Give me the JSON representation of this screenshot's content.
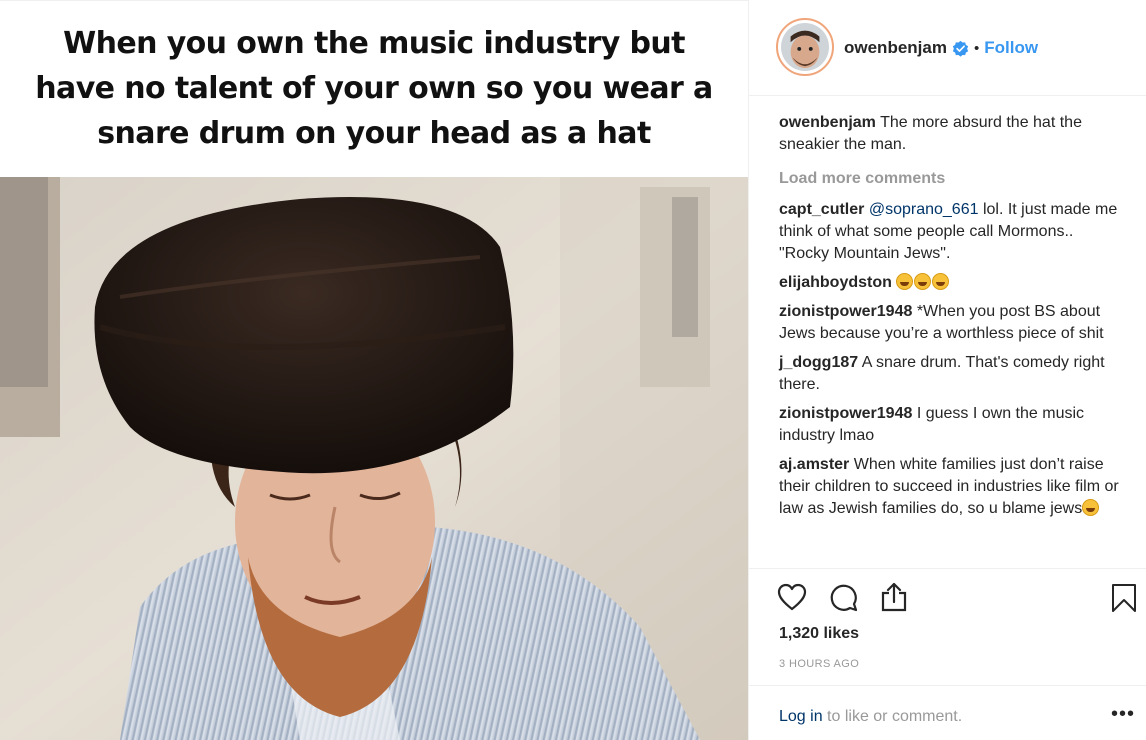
{
  "media": {
    "caption": "When you own the music industry but have no talent of your own so you wear a snare drum on your head as a hat"
  },
  "header": {
    "username": "owenbenjam",
    "separator": "•",
    "follow_label": "Follow",
    "verified_icon": "verified-badge-icon"
  },
  "caption_comment": {
    "user": "owenbenjam",
    "text": "The more absurd the hat the sneakier the man."
  },
  "load_more_label": "Load more comments",
  "comments": [
    {
      "user": "capt_cutler",
      "mention": "@soprano_661",
      "text": "lol. It just made me think of what some people call Mormons.. \"Rocky Mountain Jews\"."
    },
    {
      "user": "elijahboydston",
      "mention": "",
      "text": "",
      "emoji_count": 3
    },
    {
      "user": "zionistpower1948",
      "mention": "",
      "text": "*When you post BS about Jews because you’re a worthless piece of shit"
    },
    {
      "user": "j_dogg187",
      "mention": "",
      "text": "A snare drum. That's comedy right there."
    },
    {
      "user": "zionistpower1948",
      "mention": "",
      "text": "I guess I own the music industry lmao"
    },
    {
      "user": "aj.amster",
      "mention": "",
      "text": "When white families just don’t raise their children to succeed in industries like film or law as Jewish families do, so u blame jews",
      "emoji_count": 1
    }
  ],
  "actions": {
    "icons": [
      "heart-icon",
      "comment-bubble-icon",
      "share-icon",
      "bookmark-icon"
    ],
    "likes": "1,320 likes",
    "time": "3 HOURS AGO"
  },
  "login": {
    "link": "Log in",
    "rest": " to like or comment.",
    "more": "•••"
  },
  "colors": {
    "link_blue": "#3897f0",
    "mention_blue": "#003569",
    "muted_gray": "#999999",
    "text": "#262626"
  }
}
